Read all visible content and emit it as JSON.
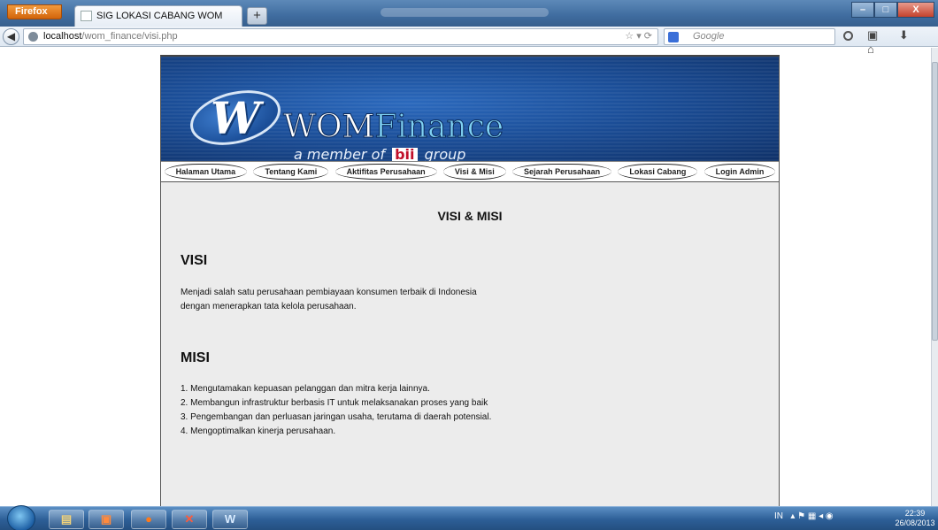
{
  "browser": {
    "app_button": "Firefox",
    "tab_title": "SIG LOKASI CABANG WOM FINANCE",
    "new_tab": "+",
    "url_host": "localhost",
    "url_path": "/wom_finance/visi.php",
    "search_placeholder": "Google",
    "window_buttons": {
      "minimize": "–",
      "maximize": "□",
      "close": "X"
    }
  },
  "banner": {
    "logo_w": "W",
    "brand_wom": "WOM",
    "brand_finance": "Finance",
    "tagline_prefix": "a member of",
    "tagline_bii": "bii",
    "tagline_suffix": "group"
  },
  "menu": {
    "items": [
      {
        "label": "Halaman Utama"
      },
      {
        "label": "Tentang Kami"
      },
      {
        "label": "Aktifitas Perusahaan"
      },
      {
        "label": "Visi & Misi"
      },
      {
        "label": "Sejarah Perusahaan"
      },
      {
        "label": "Lokasi Cabang"
      },
      {
        "label": "Login Admin"
      }
    ]
  },
  "content": {
    "page_title": "VISI & MISI",
    "visi_title": "VISI",
    "visi_line1": "Menjadi salah satu perusahaan pembiayaan konsumen terbaik di Indonesia",
    "visi_line2": "dengan menerapkan tata kelola perusahaan.",
    "misi_title": "MISI",
    "misi_items": [
      "1. Mengutamakan kepuasan pelanggan dan mitra kerja lainnya.",
      "2. Membangun infrastruktur berbasis IT untuk melaksanakan proses yang baik",
      "3. Pengembangan dan perluasan jaringan usaha, terutama di daerah potensial.",
      "4. Mengoptimalkan kinerja perusahaan."
    ]
  },
  "taskbar": {
    "language": "IN",
    "time": "22:39",
    "date": "26/08/2013"
  },
  "colors": {
    "banner_blue": "#1b4e98",
    "finance_text": "#7fd1f3",
    "page_bg": "#ececec",
    "firefox_orange": "#d2640b"
  }
}
